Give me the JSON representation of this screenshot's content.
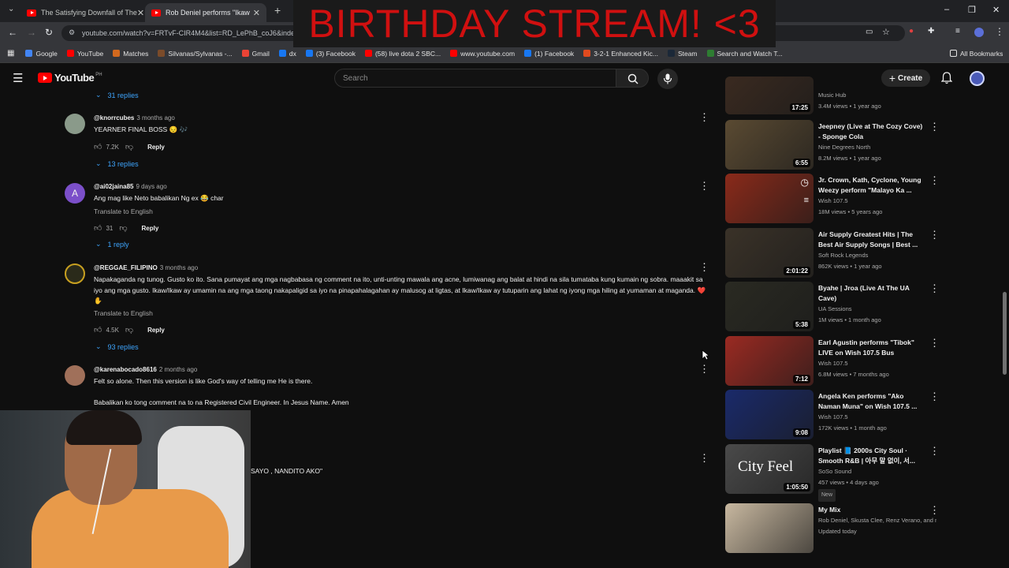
{
  "browser": {
    "tabs": [
      {
        "title": "The Satisfying Downfall of The"
      },
      {
        "title": "Rob Deniel performs \"Ikaw"
      }
    ],
    "new_tab": "+",
    "url": "youtube.com/watch?v=FRTvF-CIR4M4&list=RD_LePhB_coJ6&index=2",
    "bookmarks": [
      {
        "label": "Google",
        "color": "#4285f4"
      },
      {
        "label": "YouTube",
        "color": "#ff0000"
      },
      {
        "label": "Matches",
        "color": "#d2691e"
      },
      {
        "label": "Silvanas/Sylvanas -...",
        "color": "#7b4b2a"
      },
      {
        "label": "Gmail",
        "color": "#ea4335"
      },
      {
        "label": "dx",
        "color": "#1877f2"
      },
      {
        "label": "(3) Facebook",
        "color": "#1877f2"
      },
      {
        "label": "(58) live dota 2 SBC...",
        "color": "#ff0000"
      },
      {
        "label": "www.youtube.com",
        "color": "#ff0000"
      },
      {
        "label": "(1) Facebook",
        "color": "#1877f2"
      },
      {
        "label": "3-2-1 Enhanced Kic...",
        "color": "#e04a1f"
      },
      {
        "label": "Steam",
        "color": "#1b2838"
      },
      {
        "label": "Search and Watch T...",
        "color": "#2e7d32"
      }
    ],
    "all_bookmarks": "All Bookmarks"
  },
  "overlay": {
    "text": "BIRTHDAY STREAM! <3"
  },
  "header": {
    "logo": "YouTube",
    "logo_region": "PH",
    "search_placeholder": "Search",
    "create_label": "Create"
  },
  "comments": [
    {
      "replies_label": "31 replies"
    },
    {
      "author": "@knorrcubes",
      "ago": "3 months ago",
      "text": "YEARNER FINAL BOSS 😔 🎶",
      "likes": "7.2K",
      "reply": "Reply",
      "replies_label": "13 replies",
      "avatar_color": "#8a9a8a"
    },
    {
      "author": "@ai02jaina85",
      "ago": "9 days ago",
      "text": "Ang mag like Neto babalikan Ng ex 😂 char",
      "translate": "Translate to English",
      "likes": "31",
      "reply": "Reply",
      "replies_label": "1 reply",
      "avatar_letter": "A",
      "avatar_color": "#7b4fc9"
    },
    {
      "author": "@REGGAE_FILIPINO",
      "ago": "3 months ago",
      "text": "Napakaganda ng tunog. Gusto ko ito. Sana pumayat ang mga nagbabasa ng comment na ito, unti-unting mawala ang acne, lumiwanag ang balat at hindi na sila tumataba kung kumain ng sobra. maaakit sa iyo ang mga gusto. Ikaw/Ikaw ay umamin na ang mga taong nakapaligid sa iyo na pinapahalagahan ay malusog at ligtas, at Ikaw/Ikaw ay tutuparin ang lahat ng iyong mga hiling at yumaman at maganda. ❤️ ✋",
      "translate": "Translate to English",
      "likes": "4.5K",
      "reply": "Reply",
      "replies_label": "93 replies",
      "avatar_color": "#c8a020"
    },
    {
      "author": "@karenabocado8616",
      "ago": "2 months ago",
      "text": "Felt so alone. Then this version is like God's way of telling me He is there.",
      "text2": "Babalikan ko tong comment na to na Registered Civil Engineer. In Jesus Name. Amen",
      "avatar_color": "#a0705a"
    },
    {
      "partial_text": "SAYO , NANDITO AKO\""
    }
  ],
  "sidebar": {
    "videos": [
      {
        "title": "",
        "channel": "Music Hub",
        "meta": "3.4M views • 1 year ago",
        "duration": "17:25",
        "color": "#3a2a20"
      },
      {
        "title": "Jeepney (Live at The Cozy Cove) - Sponge Cola",
        "channel": "Nine Degrees North",
        "meta": "8.2M views • 1 year ago",
        "duration": "6:55",
        "color": "#5a4a32"
      },
      {
        "title": "Jr. Crown, Kath, Cyclone, Young Weezy perform \"Malayo Ka ...",
        "channel": "Wish 107.5",
        "meta": "18M views • 5 years ago",
        "duration": "",
        "color": "#8a2a1a"
      },
      {
        "title": "Air Supply Greatest Hits | The Best Air Supply Songs | Best ...",
        "channel": "Soft Rock Legends",
        "meta": "862K views • 1 year ago",
        "duration": "2:01:22",
        "color": "#3a3228"
      },
      {
        "title": "Byahe | Jroa (Live At The UA Cave)",
        "channel": "UA Sessions",
        "meta": "1M views • 1 month ago",
        "duration": "5:38",
        "color": "#2a2a22"
      },
      {
        "title": "Earl Agustin performs \"Tibok\" LIVE on Wish 107.5 Bus",
        "channel": "Wish 107.5",
        "meta": "6.8M views • 7 months ago",
        "duration": "7:12",
        "color": "#9a2a22"
      },
      {
        "title": "Angela Ken performs \"Ako Naman Muna\" on Wish 107.5 ...",
        "channel": "Wish 107.5",
        "meta": "172K views • 1 month ago",
        "duration": "9:08",
        "color": "#1a2a6a"
      },
      {
        "title": "Playlist 📘 2000s City Soul · Smooth R&B | 아무 말 없이, 서...",
        "channel": "SoSo Sound",
        "meta": "457 views • 4 days ago",
        "duration": "1:05:50",
        "badge": "New",
        "thumb_text": "City Feel",
        "color": "#4a4a4a"
      },
      {
        "title": "My Mix",
        "channel": "Rob Deniel, Skusta Clee, Renz Verano, and more",
        "meta": "Updated today",
        "duration": "",
        "color": "#c8b8a0"
      }
    ]
  }
}
